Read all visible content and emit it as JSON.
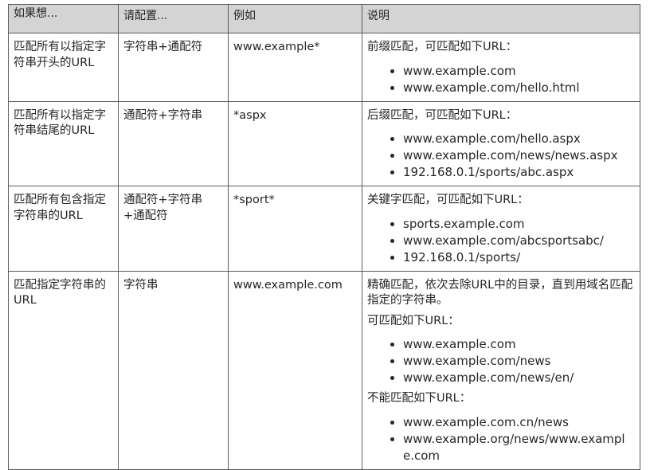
{
  "table": {
    "headers": {
      "if": "如果想...",
      "config": "请配置...",
      "example": "例如",
      "desc": "说明"
    },
    "rows": [
      {
        "if": "匹配所有以指定字符串开头的URL",
        "config": "字符串+通配符",
        "example": "www.example*",
        "desc": [
          {
            "type": "text",
            "value": "前缀匹配，可匹配如下URL："
          },
          {
            "type": "list",
            "items": [
              "www.example.com",
              "www.example.com/hello.html"
            ]
          }
        ]
      },
      {
        "if": "匹配所有以指定字符串结尾的URL",
        "config": "通配符+字符串",
        "example": "*aspx",
        "desc": [
          {
            "type": "text",
            "value": "后缀匹配，可匹配如下URL："
          },
          {
            "type": "list",
            "items": [
              "www.example.com/hello.aspx",
              "www.example.com/news/news.aspx",
              "192.168.0.1/sports/abc.aspx"
            ]
          }
        ]
      },
      {
        "if": "匹配所有包含指定字符串的URL",
        "config": "通配符+字符串+通配符",
        "example": "*sport*",
        "desc": [
          {
            "type": "text",
            "value": "关键字匹配，可匹配如下URL："
          },
          {
            "type": "list",
            "items": [
              "sports.example.com",
              "www.example.com/abcsportsabc/",
              "192.168.0.1/sports/"
            ]
          }
        ]
      },
      {
        "if": "匹配指定字符串的URL",
        "config": "字符串",
        "example": "www.example.com",
        "desc": [
          {
            "type": "text",
            "value": "精确匹配，依次去除URL中的目录，直到用域名匹配指定的字符串。"
          },
          {
            "type": "text",
            "value": "可匹配如下URL："
          },
          {
            "type": "list",
            "items": [
              "www.example.com",
              "www.example.com/news",
              "www.example.com/news/en/"
            ]
          },
          {
            "type": "text",
            "value": "不能匹配如下URL："
          },
          {
            "type": "list",
            "items": [
              "www.example.com.cn/news",
              "www.example.org/news/www.example.com"
            ]
          }
        ]
      }
    ]
  }
}
